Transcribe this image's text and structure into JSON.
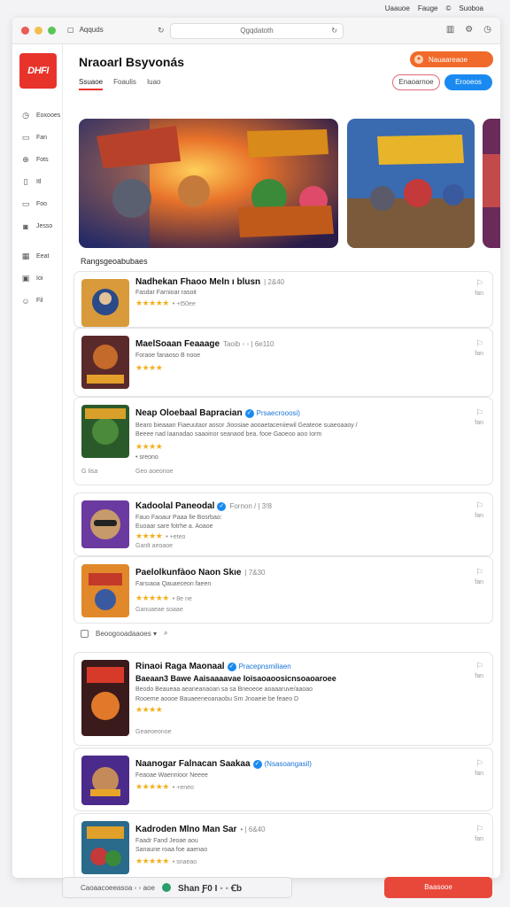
{
  "os_menu": {
    "items": [
      "Uaauoe",
      "Fauge",
      "©",
      "Suoboa"
    ]
  },
  "window": {
    "tab_label": "Aqquds",
    "url": "Qgqdatoth",
    "traffic_colors": [
      "#ec5b55",
      "#f4be4f",
      "#5bc658"
    ]
  },
  "sidebar": {
    "logo_text": "DHFI",
    "nav": [
      {
        "label": "Eoxooes",
        "icon": "clock-icon"
      },
      {
        "label": "Fan",
        "icon": "card-icon"
      },
      {
        "label": "Fots",
        "icon": "download-icon"
      },
      {
        "label": "Itl",
        "icon": "document-icon"
      },
      {
        "label": "Foo",
        "icon": "folder-icon"
      },
      {
        "label": "Jesso",
        "icon": "camera-icon"
      },
      {
        "label": "Eeat",
        "icon": "calendar-icon"
      },
      {
        "label": "Ioi",
        "icon": "square-icon"
      },
      {
        "label": "Fil",
        "icon": "people-icon"
      }
    ]
  },
  "header": {
    "title": "Nraoarl Bsyvonás",
    "tabs": [
      "Ssuaoe",
      "Foaulis",
      "Iuao"
    ],
    "promo_label": "Nauaareaoe",
    "outline_button": "Enaoarnoe",
    "primary_button": "Erooeos"
  },
  "section_label": "Rangsgeoabubaes",
  "list": [
    {
      "title": "Nadhekan Fhaoo Meln ı blusn",
      "meta": "| 2&40",
      "desc": "Fasdar Farnioar rasoit",
      "rating": "★★★★★",
      "count": "• +t50ee",
      "side": [
        "Lo",
        "fan"
      ]
    },
    {
      "title": "MaelSoaan Feaaage",
      "meta": "Taoib ◦ ◦ | 6e110",
      "desc": "Foraoe fanaoso B nooe",
      "rating": "★★★★",
      "count": "",
      "side": [
        "Lo",
        "fan"
      ]
    },
    {
      "title": "Neap Oloebaal Bapracian",
      "tag": "Prsaecrooosi)",
      "desc": "Bearo bieaaan Fiaeuutaor aosor Jioosiae aooaetaceniiewil Geateoe suaeoaaoy /",
      "desc2": "Beeee nad Iaanadao saaoinor seanaod bea. fooe Gaoeoo aoo Iorm",
      "rating": "★★★★",
      "count": "• sreono",
      "foot_left": "G Iisa",
      "foot_right": "Geo aoeonoe",
      "side": [
        "Lo",
        "fan"
      ]
    },
    {
      "title": "Kadoolal Paneodal",
      "tag": "Fornon / | 3!8",
      "desc": "Fauo Faoaur Paaa fie Bosrbao:",
      "desc2": "Euoaar sare fotrhe a. Aoaoe",
      "rating": "★★★★",
      "count": "• +eteo",
      "foot_right": "Ganlt aeoaoe",
      "side": [
        "Lo",
        "fan"
      ]
    },
    {
      "title": "Paelolkunfàoo Naon Skıe",
      "meta": "| 7&30",
      "desc": "Farsıaoa Qauaeceon faeen",
      "rating": "★★★★★",
      "count": "• 8e ne",
      "foot_right": "Ganuaeae soaae",
      "side": [
        "Lo",
        "fan"
      ]
    },
    {
      "title": "Rinaoi Raga Maonaal",
      "tag": "Pracepnsmiliaen",
      "title2": "Baeaan3 Bawe Aaisaaaavae Ioisaoaoosicnsoaoaroee",
      "desc": "Beodo Beaueaa aeaneanaoan sa sa Bneoeoe aoaaaruve/aaoao",
      "desc2": "Rooeme aoooe Bauaeeneoanaobu Sm Jnoaeie be feaeo D",
      "rating": "★★★★",
      "count": "",
      "foot_right": "Geaeoeonoe",
      "side": [
        "Lo",
        "fan"
      ]
    },
    {
      "title": "Naanogar Falnacan Saakaa",
      "tag": "(Nsasoangasil)",
      "desc": "Feaoae Waennioor Neeee",
      "rating": "★★★★★",
      "count": "• +eneo",
      "side": [
        "Lo",
        "fan"
      ]
    },
    {
      "title": "Kadroden Mlno Man Sar",
      "meta": "• | 6&40",
      "desc": "Faadr Fand Jeoae aou",
      "desc2": "Sanaune roaa foe aaenao",
      "rating": "★★★★★",
      "count": "• snaeao",
      "side": [
        "Lo",
        "fan"
      ]
    }
  ],
  "filter_row": {
    "label": "Beoogooadaaoes ▾"
  },
  "bottom": {
    "chip_text": "Caoaacoeeasoa ◦ ◦ aoe",
    "chip_bold": "Shan Ƒ0 I ◦ ◦ Ꞓb",
    "button": "Baasooe"
  }
}
